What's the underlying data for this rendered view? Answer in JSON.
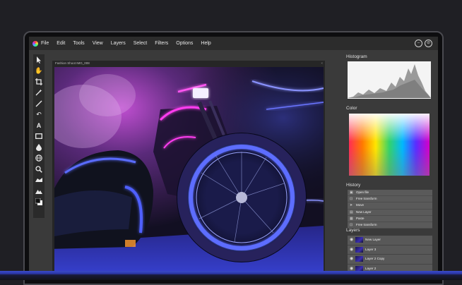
{
  "menubar": {
    "items": [
      "File",
      "Edit",
      "Tools",
      "View",
      "Layers",
      "Select",
      "Filters",
      "Options",
      "Help"
    ],
    "window_buttons": [
      "minimize-icon",
      "close-icon"
    ]
  },
  "toolbar": {
    "tools": [
      "pointer-icon",
      "hand-icon",
      "crop-icon",
      "magic-wand-icon",
      "line-icon",
      "undo-icon",
      "text-icon",
      "rectangle-icon",
      "drop-icon",
      "globe-icon",
      "zoom-icon",
      "smudge-icon",
      "mountain-icon",
      "color-swatch-icon"
    ]
  },
  "canvas": {
    "title": "Fashion Shoot IMG_008"
  },
  "panels": {
    "histogram": {
      "title": "Histogram"
    },
    "color": {
      "title": "Color"
    },
    "history": {
      "title": "History",
      "items": [
        {
          "label": "Open file",
          "icon": "file-icon"
        },
        {
          "label": "Free transform",
          "icon": "transform-icon"
        },
        {
          "label": "Move",
          "icon": "move-icon"
        },
        {
          "label": "New Layer",
          "icon": "layer-icon"
        },
        {
          "label": "Paste",
          "icon": "paste-icon"
        },
        {
          "label": "Free transform",
          "icon": "transform-icon"
        }
      ]
    },
    "layers": {
      "title": "Layers",
      "items": [
        {
          "name": "New Layer"
        },
        {
          "name": "Layer 3"
        },
        {
          "name": "Layer 2 Copy"
        },
        {
          "name": "Layer 2"
        }
      ]
    }
  },
  "colors": {
    "accent": "#2f3fc0",
    "neon_blue": "#4a5cff",
    "neon_pink": "#ff3cf0",
    "panel_bg": "#3a3a3a"
  }
}
